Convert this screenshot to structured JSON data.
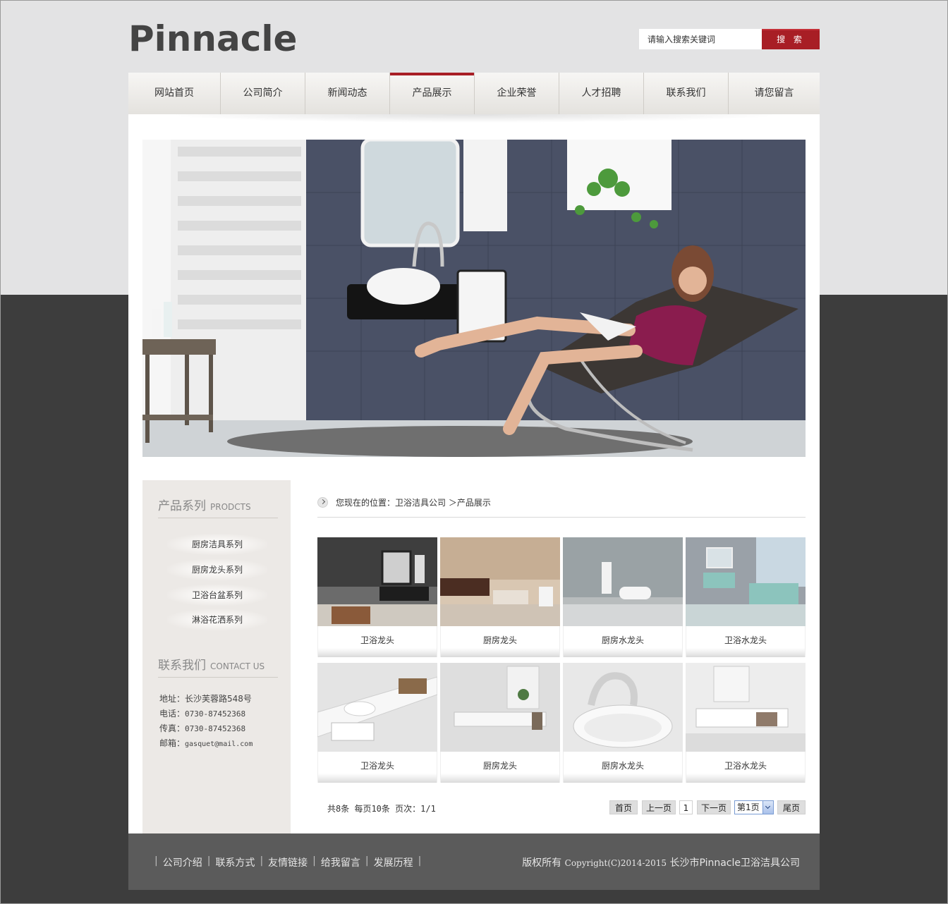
{
  "header": {
    "logo": "Pinnacle",
    "search_placeholder": "请输入搜索关键词",
    "search_value": "请输入搜索关键词",
    "search_button": "搜 索"
  },
  "nav": {
    "items": [
      "网站首页",
      "公司简介",
      "新闻动态",
      "产品展示",
      "企业荣誉",
      "人才招聘",
      "联系我们",
      "请您留言"
    ],
    "active": "产品展示",
    "accent_color": "#a81e25"
  },
  "sidebar": {
    "products_title_cn": "产品系列",
    "products_title_en": "PRODCTS",
    "products": [
      "厨房洁具系列",
      "厨房龙头系列",
      "卫浴台盆系列",
      "淋浴花洒系列"
    ],
    "contact_title_cn": "联系我们",
    "contact_title_en": "CONTACT US",
    "address_label": "地址：",
    "address": "长沙芙蓉路548号",
    "phone_label": "电话：",
    "phone": "0730-87452368",
    "fax_label": "传真：",
    "fax": "0730-87452368",
    "email_label": "邮箱：",
    "email": "gasquet@mail.com"
  },
  "breadcrumb": {
    "text": "您现在的位置：卫浴洁具公司 ＞产品展示"
  },
  "products": [
    {
      "caption": "卫浴龙头"
    },
    {
      "caption": "厨房龙头"
    },
    {
      "caption": "厨房水龙头"
    },
    {
      "caption": "卫浴水龙头"
    },
    {
      "caption": "卫浴龙头"
    },
    {
      "caption": "厨房龙头"
    },
    {
      "caption": "厨房水龙头"
    },
    {
      "caption": "卫浴水龙头"
    }
  ],
  "pagination": {
    "info": "共8条  每页10条  页次：1/1",
    "first": "首页",
    "prev": "上一页",
    "current": "1",
    "next": "下一页",
    "select": "第1页",
    "last": "尾页"
  },
  "footer": {
    "links": [
      "公司介绍",
      "联系方式",
      "友情链接",
      "给我留言",
      "发展历程"
    ],
    "separator": "|",
    "copyright_prefix": "版权所有 ",
    "copyright_mid": "Copyright(C)2014-2015",
    "copyright_suffix": " 长沙市Pinnacle卫浴洁具公司"
  }
}
